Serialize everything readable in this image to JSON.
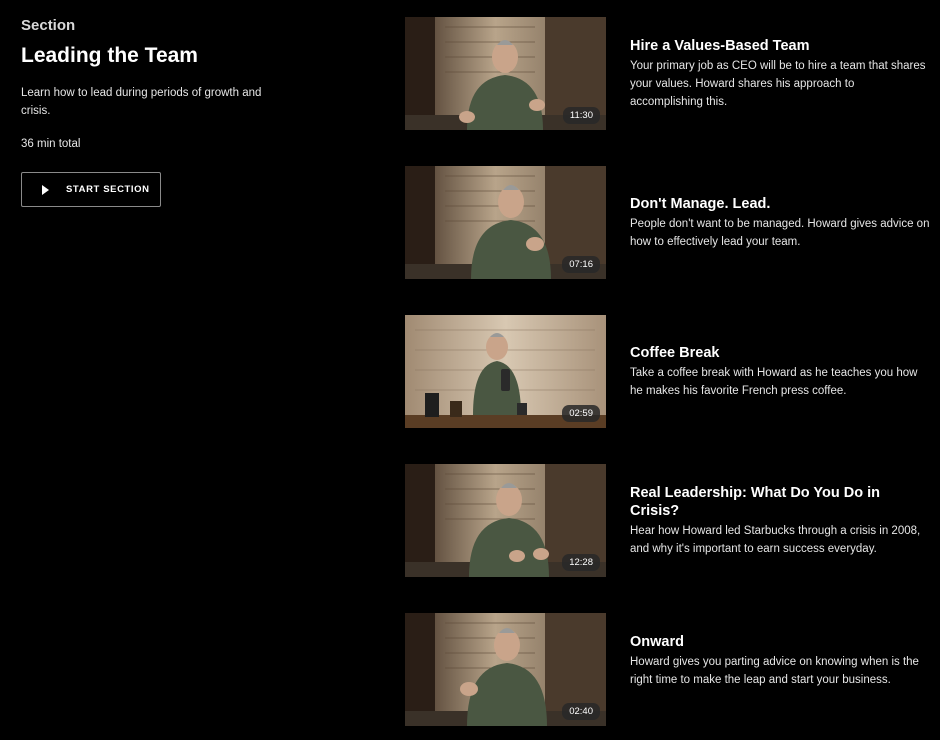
{
  "section": {
    "kicker": "Section",
    "title": "Leading the Team",
    "description": "Learn how to lead during periods of growth and crisis.",
    "total": "36 min total",
    "start_label": "START SECTION"
  },
  "lessons": [
    {
      "title": "Hire a Values-Based Team",
      "description": "Your primary job as CEO will be to hire a team that shares your values. Howard shares his approach to accomplishing this.",
      "duration": "11:30"
    },
    {
      "title": "Don't Manage. Lead.",
      "description": "People don't want to be managed. Howard gives advice on how to effectively lead your team.",
      "duration": "07:16"
    },
    {
      "title": "Coffee Break",
      "description": "Take a coffee break with Howard as he teaches you how he makes his favorite French press coffee.",
      "duration": "02:59"
    },
    {
      "title": "Real Leadership: What Do You Do in Crisis?",
      "description": "Hear how Howard led Starbucks through a crisis in 2008, and why it's important to earn success everyday.",
      "duration": "12:28"
    },
    {
      "title": "Onward",
      "description": "Howard gives you parting advice on knowing when is the right time to make the leap and start your business.",
      "duration": "02:40"
    }
  ]
}
